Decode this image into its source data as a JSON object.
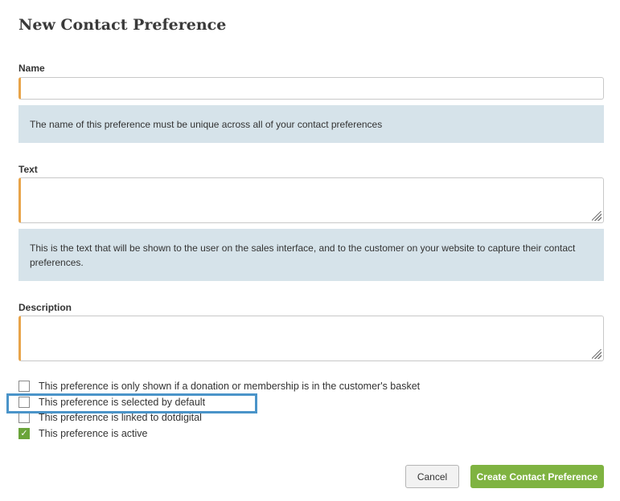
{
  "form": {
    "title": "New Contact Preference",
    "name": {
      "label": "Name",
      "value": "",
      "help": "The name of this preference must be unique across all of your contact preferences"
    },
    "text": {
      "label": "Text",
      "value": "",
      "help": "This is the text that will be shown to the user on the sales interface, and to the customer on your website to capture their contact preferences."
    },
    "description": {
      "label": "Description",
      "value": ""
    },
    "options": [
      {
        "label": "This preference is only shown if a donation or membership is in the customer's basket",
        "checked": false
      },
      {
        "label": "This preference is selected by default",
        "checked": false
      },
      {
        "label": "This preference is linked to dotdigital",
        "checked": false
      },
      {
        "label": "This preference is active",
        "checked": true
      }
    ],
    "actions": {
      "cancel": "Cancel",
      "create": "Create Contact Preference"
    },
    "colors": {
      "required_accent": "#e8a44a",
      "help_background": "#d6e3ea",
      "primary_button": "#7fb341",
      "highlight": "#4a94c9",
      "checked": "#6aa43a"
    }
  }
}
